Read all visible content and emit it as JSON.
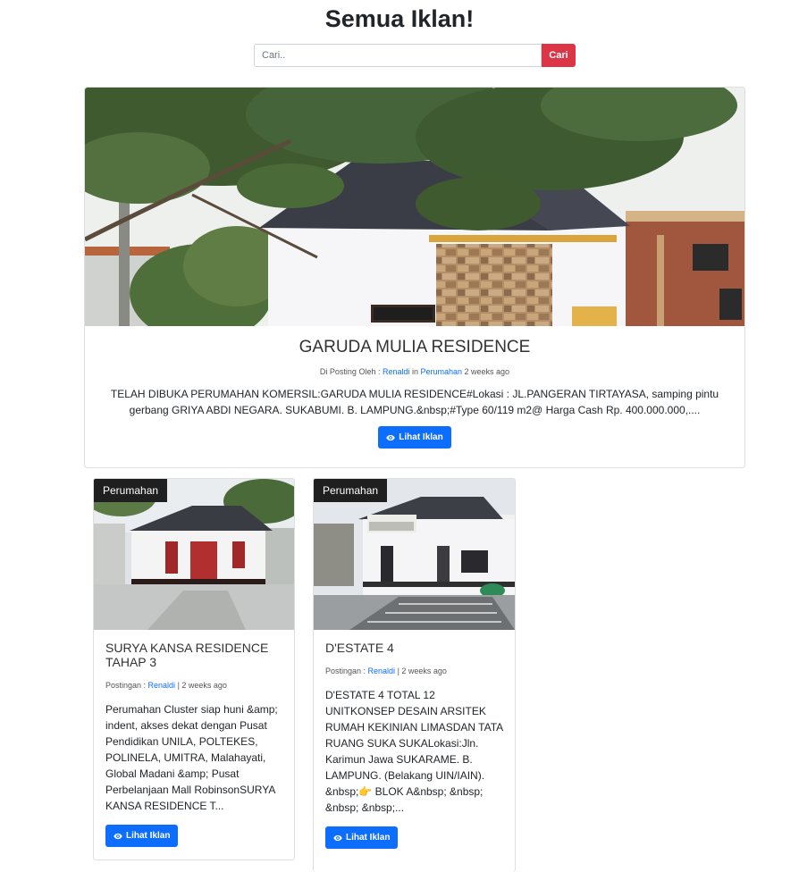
{
  "page": {
    "title": "Semua Iklan!"
  },
  "search": {
    "placeholder": "Cari..",
    "button_label": "Cari"
  },
  "featured": {
    "title": "GARUDA MULIA RESIDENCE",
    "meta_prefix": "Di Posting Oleh : ",
    "author": "Renaldi",
    "in_word": " in ",
    "category": "Perumahan",
    "time": " 2 weeks ago",
    "description": "TELAH DIBUKA PERUMAHAN KOMERSIL:GARUDA MULIA RESIDENCE#Lokasi : JL.PANGERAN TIRTAYASA, samping pintu gerbang GRIYA ABDI NEGARA. SUKABUMI. B. LAMPUNG.&nbsp;#Type 60/119 m2@ Harga Cash Rp. 400.000.000,....",
    "button_label": "Lihat Iklan"
  },
  "listings": [
    {
      "category": "Perumahan",
      "title": "SURYA KANSA RESIDENCE TAHAP 3",
      "meta_prefix": "Postingan : ",
      "author": "Renaldi",
      "time": " | 2 weeks ago",
      "description": "Perumahan Cluster siap huni &amp; indent, akses dekat dengan Pusat Pendidikan UNILA, POLTEKES, POLINELA, UMITRA, Malahayati, Global Madani &amp; Pusat Perbelanjaan Mall RobinsonSURYA KANSA RESIDENCE T...",
      "button_label": "Lihat Iklan"
    },
    {
      "category": "Perumahan",
      "title": "D'ESTATE 4",
      "meta_prefix": "Postingan : ",
      "author": "Renaldi",
      "time": " | 2 weeks ago",
      "description": "D'ESTATE 4 TOTAL 12 UNITKONSEP DESAIN ARSITEK RUMAH KEKINIAN LIMASDAN TATA RUANG SUKA SUKALokasi:Jln. Karimun Jawa SUKARAME. B. LAMPUNG. (Belakang UIN/IAIN). &nbsp;👉 BLOK A&nbsp; &nbsp; &nbsp; &nbsp;...",
      "button_label": "Lihat Iklan"
    }
  ],
  "colors": {
    "primary": "#0d6efd",
    "danger": "#dc3545",
    "badge": "#1f1f1f"
  },
  "icons": {
    "view_button": "eye-icon"
  }
}
